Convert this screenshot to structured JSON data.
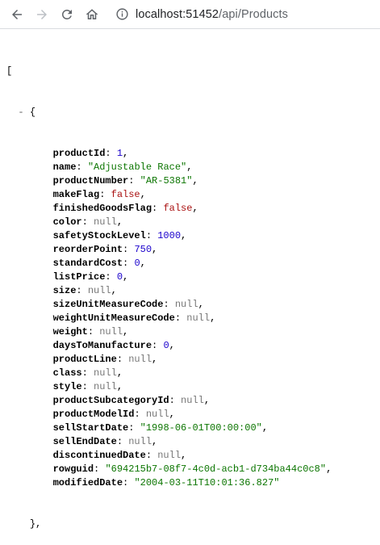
{
  "browser": {
    "url_host": "localhost:51452",
    "url_path": "/api/Products"
  },
  "json_viewer": {
    "open_bracket": "[",
    "collapser": "-",
    "open_brace": "{",
    "close_brace": "},",
    "fields": [
      {
        "key": "productId",
        "value": "1",
        "type": "num"
      },
      {
        "key": "name",
        "value": "\"Adjustable Race\"",
        "type": "str"
      },
      {
        "key": "productNumber",
        "value": "\"AR-5381\"",
        "type": "str"
      },
      {
        "key": "makeFlag",
        "value": "false",
        "type": "bool"
      },
      {
        "key": "finishedGoodsFlag",
        "value": "false",
        "type": "bool"
      },
      {
        "key": "color",
        "value": "null",
        "type": "null"
      },
      {
        "key": "safetyStockLevel",
        "value": "1000",
        "type": "num"
      },
      {
        "key": "reorderPoint",
        "value": "750",
        "type": "num"
      },
      {
        "key": "standardCost",
        "value": "0",
        "type": "num"
      },
      {
        "key": "listPrice",
        "value": "0",
        "type": "num"
      },
      {
        "key": "size",
        "value": "null",
        "type": "null"
      },
      {
        "key": "sizeUnitMeasureCode",
        "value": "null",
        "type": "null"
      },
      {
        "key": "weightUnitMeasureCode",
        "value": "null",
        "type": "null"
      },
      {
        "key": "weight",
        "value": "null",
        "type": "null"
      },
      {
        "key": "daysToManufacture",
        "value": "0",
        "type": "num"
      },
      {
        "key": "productLine",
        "value": "null",
        "type": "null"
      },
      {
        "key": "class",
        "value": "null",
        "type": "null"
      },
      {
        "key": "style",
        "value": "null",
        "type": "null"
      },
      {
        "key": "productSubcategoryId",
        "value": "null",
        "type": "null"
      },
      {
        "key": "productModelId",
        "value": "null",
        "type": "null"
      },
      {
        "key": "sellStartDate",
        "value": "\"1998-06-01T00:00:00\"",
        "type": "str"
      },
      {
        "key": "sellEndDate",
        "value": "null",
        "type": "null"
      },
      {
        "key": "discontinuedDate",
        "value": "null",
        "type": "null"
      },
      {
        "key": "rowguid",
        "value": "\"694215b7-08f7-4c0d-acb1-d734ba44c0c8\"",
        "type": "str"
      },
      {
        "key": "modifiedDate",
        "value": "\"2004-03-11T10:01:36.827\"",
        "type": "str"
      }
    ]
  }
}
